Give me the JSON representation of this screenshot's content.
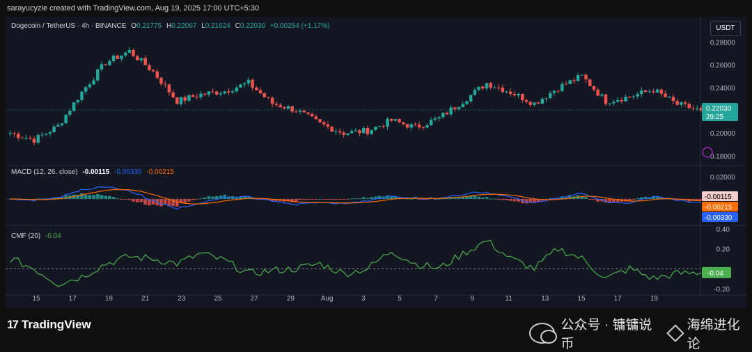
{
  "header_text": "sarayucyzie created with TradingView.com, Aug 19, 2025 17:00 UTC+5:30",
  "legend": {
    "symbol": "Dogecoin / TetherUS · 4h · BINANCE",
    "o_label": "O",
    "o_value": "0.21775",
    "h_label": "H",
    "h_value": "0.22067",
    "l_label": "L",
    "l_value": "0.21624",
    "c_label": "C",
    "c_value": "0.22030",
    "change": "+0.00254 (+1.17%)"
  },
  "currency_button": "USDT",
  "price_axis_labels": [
    "0.28000",
    "0.26000",
    "0.24000",
    "0.20000",
    "0.18000"
  ],
  "current_price": "0.22030",
  "countdown": "29:25",
  "macd": {
    "label": "MACD (12, 26, close)",
    "hist_value": "-0.00115",
    "macd_value": "-0.00330",
    "signal_value": "-0.00215",
    "axis_top": "0.02000",
    "badges": [
      "-0.00115",
      "-0.00215",
      "-0.00330"
    ]
  },
  "cmf": {
    "label": "CMF (20)",
    "value": "-0.04",
    "axis_labels": [
      "0.40",
      "0.20",
      "-0.20"
    ],
    "badge": "-0.04"
  },
  "x_labels": [
    "15",
    "17",
    "19",
    "21",
    "23",
    "25",
    "27",
    "29",
    "Aug",
    "3",
    "5",
    "7",
    "9",
    "11",
    "13",
    "15",
    "17",
    "19"
  ],
  "brand": {
    "logo_mark": "17",
    "name": "TradingView"
  },
  "watermark": {
    "account": "公众号 · 镛镛说币",
    "brand": "海绵进化论"
  },
  "colors": {
    "up": "#26a69a",
    "down": "#ef5350",
    "macd": "#2962ff",
    "signal": "#ff6d00",
    "cmf": "#4caf50",
    "bg": "#131722"
  },
  "chart_data": {
    "type": "candlestick",
    "ylim": [
      0.175,
      0.295
    ],
    "x": [
      "15",
      "17",
      "19",
      "21",
      "23",
      "25",
      "27",
      "29",
      "Aug",
      "3",
      "5",
      "7",
      "9",
      "11",
      "13",
      "15",
      "17",
      "19"
    ],
    "close": [
      0.2,
      0.194,
      0.206,
      0.236,
      0.262,
      0.272,
      0.254,
      0.228,
      0.234,
      0.237,
      0.244,
      0.226,
      0.22,
      0.208,
      0.2,
      0.202,
      0.211,
      0.205,
      0.213,
      0.228,
      0.244,
      0.236,
      0.226,
      0.24,
      0.25,
      0.228,
      0.232,
      0.238,
      0.225,
      0.22
    ],
    "macd_hist_range": [
      -0.006,
      0.002
    ],
    "cmf_range": [
      -0.25,
      0.42
    ],
    "cmf_values": [
      0.1,
      0.0,
      -0.15,
      -0.08,
      0.05,
      0.12,
      0.1,
      0.05,
      0.15,
      0.08,
      -0.05,
      -0.02,
      0.0,
      0.05,
      -0.05,
      0.0,
      0.18,
      0.05,
      0.0,
      0.15,
      0.28,
      0.1,
      0.0,
      0.2,
      0.1,
      -0.1,
      0.0,
      -0.1,
      -0.05,
      -0.04
    ]
  }
}
